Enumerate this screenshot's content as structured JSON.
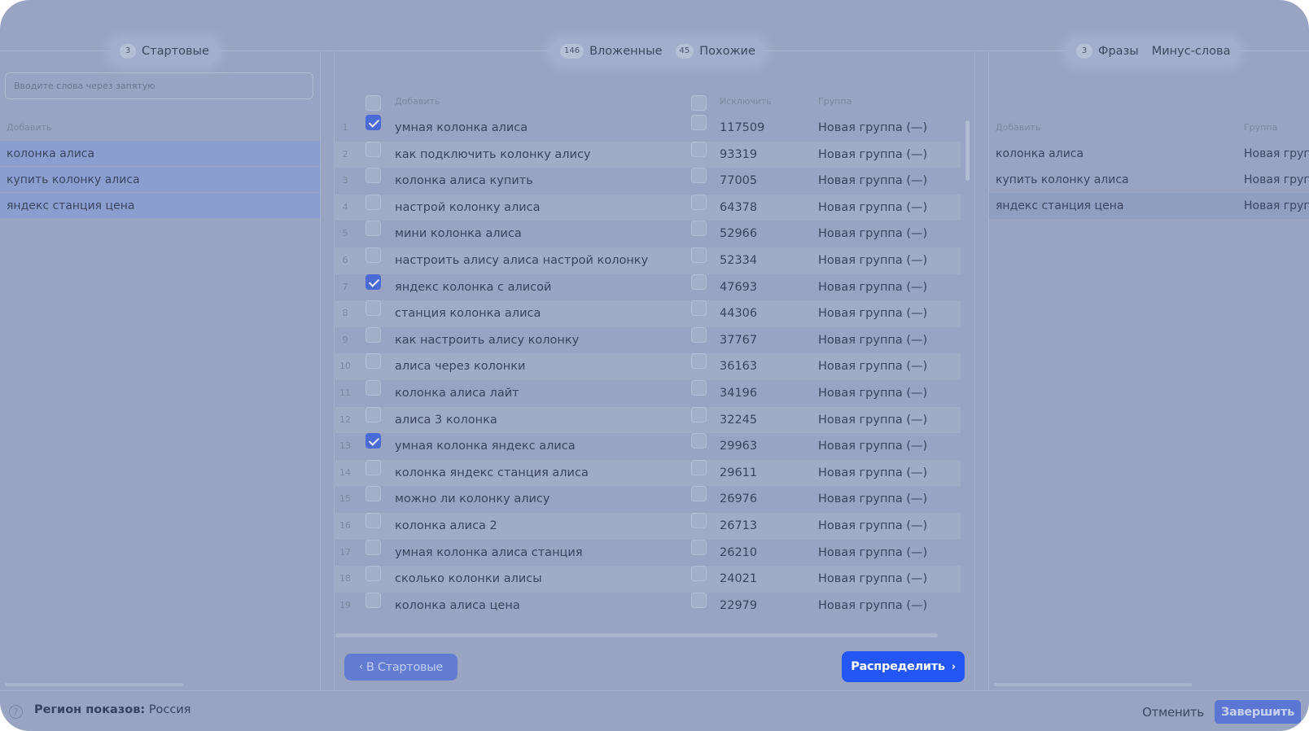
{
  "tabs": {
    "seeds": {
      "count": "3",
      "label": "Стартовые"
    },
    "nested": {
      "count": "146",
      "label": "Вложенные"
    },
    "similar": {
      "count": "45",
      "label": "Похожие"
    },
    "phrases": {
      "count": "3",
      "label": "Фразы"
    },
    "minus": {
      "label": "Минус-слова"
    }
  },
  "left": {
    "placeholder": "Вводите слова через запятую",
    "add_header": "Добавить",
    "items": [
      "колонка алиса",
      "купить колонку алиса",
      "яндекс станция цена"
    ]
  },
  "middle": {
    "headers": {
      "add": "Добавить",
      "exclude": "Исключить",
      "group": "Группа"
    },
    "rows": [
      {
        "n": "1",
        "checked": true,
        "phrase": "умная колонка алиса",
        "count": "117509",
        "group": "Новая группа (—)"
      },
      {
        "n": "2",
        "checked": false,
        "phrase": "как подключить колонку алису",
        "count": "93319",
        "group": "Новая группа (—)"
      },
      {
        "n": "3",
        "checked": false,
        "phrase": "колонка алиса купить",
        "count": "77005",
        "group": "Новая группа (—)"
      },
      {
        "n": "4",
        "checked": false,
        "phrase": "настрой колонку алиса",
        "count": "64378",
        "group": "Новая группа (—)"
      },
      {
        "n": "5",
        "checked": false,
        "phrase": "мини колонка алиса",
        "count": "52966",
        "group": "Новая группа (—)"
      },
      {
        "n": "6",
        "checked": false,
        "phrase": "настроить алису алиса настрой колонку",
        "count": "52334",
        "group": "Новая группа (—)"
      },
      {
        "n": "7",
        "checked": true,
        "phrase": "яндекс колонка с алисой",
        "count": "47693",
        "group": "Новая группа (—)"
      },
      {
        "n": "8",
        "checked": false,
        "phrase": "станция колонка алиса",
        "count": "44306",
        "group": "Новая группа (—)"
      },
      {
        "n": "9",
        "checked": false,
        "phrase": "как настроить алису колонку",
        "count": "37767",
        "group": "Новая группа (—)"
      },
      {
        "n": "10",
        "checked": false,
        "phrase": "алиса через колонки",
        "count": "36163",
        "group": "Новая группа (—)"
      },
      {
        "n": "11",
        "checked": false,
        "phrase": "колонка алиса лайт",
        "count": "34196",
        "group": "Новая группа (—)"
      },
      {
        "n": "12",
        "checked": false,
        "phrase": "алиса 3 колонка",
        "count": "32245",
        "group": "Новая группа (—)"
      },
      {
        "n": "13",
        "checked": true,
        "phrase": "умная колонка яндекс алиса",
        "count": "29963",
        "group": "Новая группа (—)"
      },
      {
        "n": "14",
        "checked": false,
        "phrase": "колонка яндекс станция алиса",
        "count": "29611",
        "group": "Новая группа (—)"
      },
      {
        "n": "15",
        "checked": false,
        "phrase": "можно ли колонку алису",
        "count": "26976",
        "group": "Новая группа (—)"
      },
      {
        "n": "16",
        "checked": false,
        "phrase": "колонка алиса 2",
        "count": "26713",
        "group": "Новая группа (—)"
      },
      {
        "n": "17",
        "checked": false,
        "phrase": "умная колонка алиса станция",
        "count": "26210",
        "group": "Новая группа (—)"
      },
      {
        "n": "18",
        "checked": false,
        "phrase": "сколько колонки алисы",
        "count": "24021",
        "group": "Новая группа (—)"
      },
      {
        "n": "19",
        "checked": false,
        "phrase": "колонка алиса цена",
        "count": "22979",
        "group": "Новая группа (—)"
      }
    ],
    "back_button": "В Стартовые",
    "distribute_button": "Распределить"
  },
  "right": {
    "headers": {
      "add": "Добавить",
      "group": "Группа"
    },
    "items": [
      {
        "phrase": "колонка алиса",
        "group": "Новая группа (—)"
      },
      {
        "phrase": "купить колонку алиса",
        "group": "Новая группа (—)"
      },
      {
        "phrase": "яндекс станция цена",
        "group": "Новая группа (—)"
      }
    ]
  },
  "footer": {
    "help_icon_glyph": "?",
    "region_label": "Регион показов:",
    "region_value": "Россия",
    "cancel_button": "Отменить",
    "finish_button": "Завершить"
  },
  "colors": {
    "overlay_background": "#98a4c1",
    "primary_button": "#2456f6",
    "checkbox_checked": "#4a6bd6",
    "highlight_row": "#8a9fcf"
  }
}
